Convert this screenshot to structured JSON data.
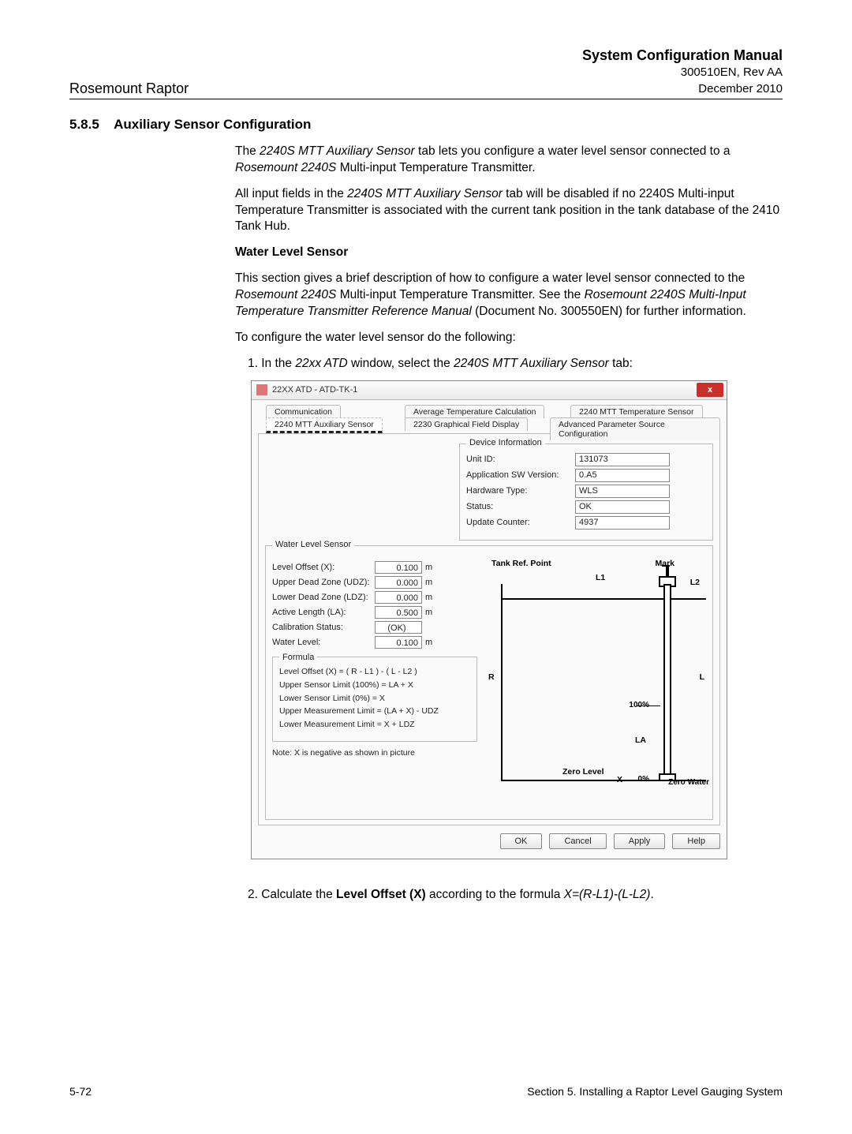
{
  "header": {
    "left": "Rosemount Raptor",
    "right_bold": "System Configuration Manual",
    "right_line2": "300510EN, Rev AA",
    "right_line3": "December 2010"
  },
  "section": {
    "number": "5.8.5",
    "title": "Auxiliary Sensor Configuration"
  },
  "paras": {
    "p1a": "The ",
    "p1b": "2240S MTT Auxiliary Sensor",
    "p1c": " tab lets you configure a water level sensor connected to a ",
    "p1d": "Rosemount 2240S",
    "p1e": " Multi-input Temperature Transmitter.",
    "p2a": "All input fields in the ",
    "p2b": "2240S MTT Auxiliary Sensor",
    "p2c": " tab will be disabled if no 2240S Multi-input Temperature Transmitter is associated with the current tank position in the tank database of the 2410 Tank Hub.",
    "h1": "Water Level Sensor",
    "p3a": "This section gives a brief description of how to configure a water level sensor connected to the ",
    "p3b": "Rosemount 2240S",
    "p3c": " Multi-input Temperature Transmitter. See the ",
    "p3d": "Rosemount 2240S Multi-Input Temperature Transmitter Reference Manual",
    "p3e": " (Document No. 300550EN) for further information.",
    "p4": "To configure the water level sensor do the following:",
    "li1a": "1. In the ",
    "li1b": "22xx ATD",
    "li1c": " window, select the ",
    "li1d": "2240S MTT Auxiliary Sensor",
    "li1e": " tab:",
    "li2a": "2. Calculate the ",
    "li2b": "Level Offset (X)",
    "li2c": " according to the formula ",
    "li2d": "X=(R-L1)-(L-L2)",
    "li2e": "."
  },
  "window": {
    "title": "22XX ATD  - ATD-TK-1",
    "tabs": {
      "t1": "Communication",
      "t2": "Average Temperature Calculation",
      "t3": "2240 MTT Temperature Sensor",
      "t4": "2240 MTT Auxiliary Sensor",
      "t5": "2230 Graphical Field Display",
      "t6": "Advanced Parameter Source Configuration"
    },
    "devinfo": {
      "title": "Device Information",
      "rows": [
        {
          "label": "Unit ID:",
          "value": "131073"
        },
        {
          "label": "Application SW Version:",
          "value": "0.A5"
        },
        {
          "label": "Hardware Type:",
          "value": "WLS"
        },
        {
          "label": "Status:",
          "value": "OK"
        },
        {
          "label": "Update Counter:",
          "value": "4937"
        }
      ]
    },
    "wls": {
      "title": "Water Level Sensor",
      "rows": [
        {
          "label": "Level Offset (X):",
          "value": "0.100",
          "unit": "m"
        },
        {
          "label": "Upper Dead Zone (UDZ):",
          "value": "0.000",
          "unit": "m"
        },
        {
          "label": "Lower Dead Zone (LDZ):",
          "value": "0.000",
          "unit": "m"
        },
        {
          "label": "Active Length (LA):",
          "value": "0.500",
          "unit": "m"
        },
        {
          "label": "Calibration Status:",
          "value": "(OK)",
          "unit": ""
        },
        {
          "label": "Water Level:",
          "value": "0.100",
          "unit": "m"
        }
      ],
      "formula_title": "Formula",
      "formulas": [
        "Level Offset (X) = ( R - L1 ) - ( L - L2 )",
        "Upper Sensor Limit (100%) = LA + X",
        "Lower Sensor Limit (0%) =  X",
        "Upper Measurement Limit = (LA + X) - UDZ",
        "Lower Measurement Limit =  X + LDZ"
      ],
      "note": "Note: X is negative as shown in picture"
    },
    "diagram": {
      "tank_ref": "Tank Ref. Point",
      "mark": "Mark",
      "L1": "L1",
      "L2": "L2",
      "R": "R",
      "L": "L",
      "p100": "100%",
      "p0": "0%",
      "LA": "LA",
      "X": "X",
      "zero_level": "Zero Level",
      "zero_water": "Zero Water"
    },
    "buttons": {
      "ok": "OK",
      "cancel": "Cancel",
      "apply": "Apply",
      "help": "Help"
    }
  },
  "footer": {
    "left": "5-72",
    "right": "Section 5. Installing a Raptor Level Gauging System"
  }
}
